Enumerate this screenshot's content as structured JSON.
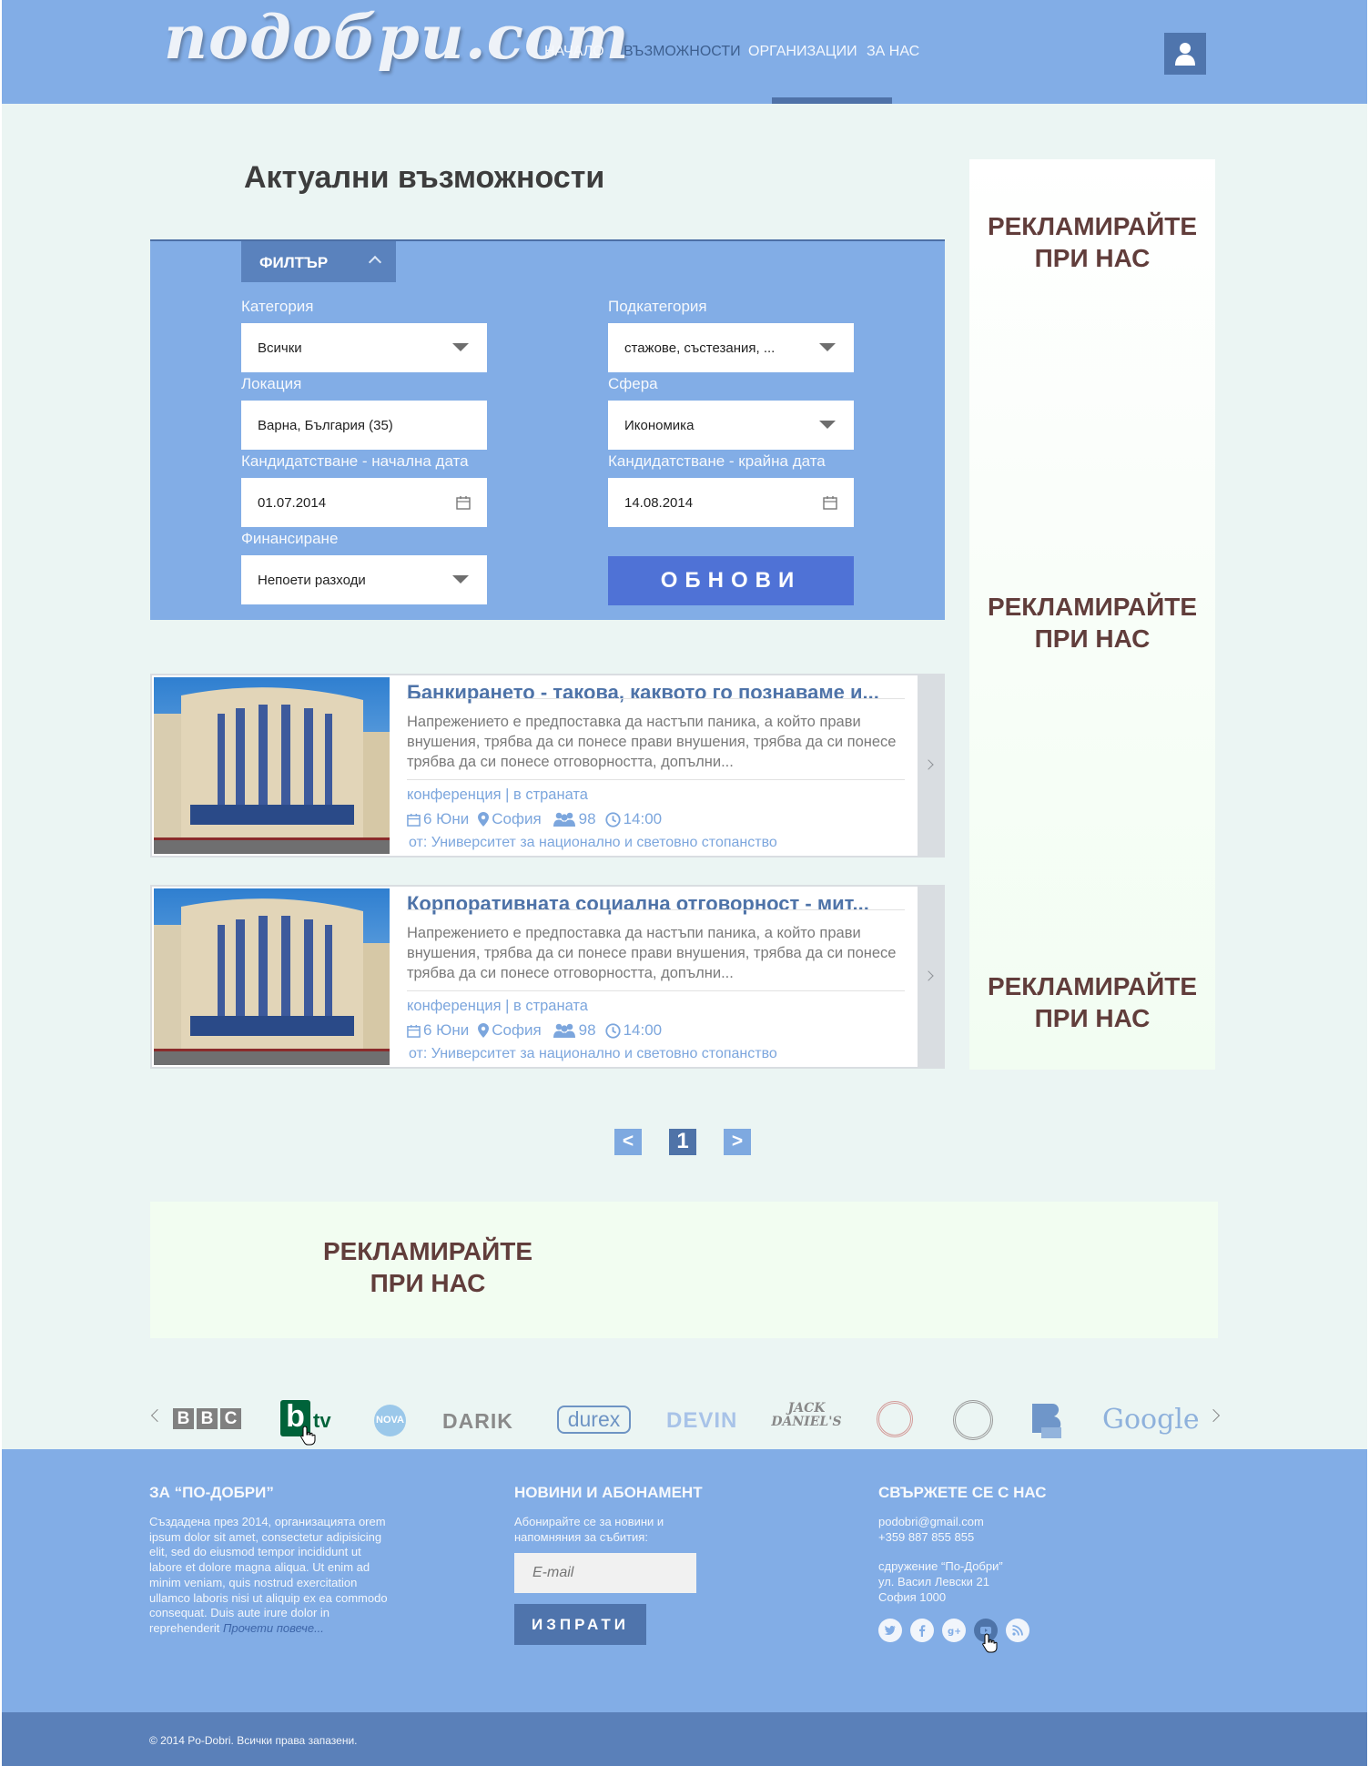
{
  "header": {
    "logo": "подобри.com",
    "nav": [
      "НАЧАЛО",
      "ВЪЗМОЖНОСТИ",
      "ОРГАНИЗАЦИИ",
      "ЗА НАС"
    ],
    "active_nav": "ВЪЗМОЖНОСТИ",
    "user_icon": "user-icon"
  },
  "page": {
    "title": "Актуални възможности"
  },
  "filter": {
    "tab_label": "ФИЛТЪР",
    "category_label": "Категория",
    "category_value": "Всички",
    "subcategory_label": "Подкатегория",
    "subcategory_value": "стажове, състезания, ...",
    "location_label": "Локация",
    "location_value": "Варна, България (35)",
    "sphere_label": "Сфера",
    "sphere_value": "Икономика",
    "start_label": "Кандидатстване - начална дата",
    "start_value": "01.07.2014",
    "end_label": "Кандидатстване - крайна дата",
    "end_value": "14.08.2014",
    "funding_label": "Финансиране",
    "funding_value": "Непоети разходи",
    "update_button": "ОБНОВИ"
  },
  "cards": [
    {
      "title": "Банкирането - такова, каквото го познаваме и...",
      "desc": "Напрежението е предпоставка да настъпи паника, а който прави внушения, трябва да си понесе прави внушения, трябва да си понесе трябва да си понесе отговорността, допълни...",
      "tags": "конференция | в страната",
      "date": "6 Юни",
      "city": "София",
      "people": "98",
      "time": "14:00",
      "org": "от: Университет за национално и световно стопанство"
    },
    {
      "title": "Корпоративната социална отговорност - мит...",
      "desc": "Напрежението е предпоставка да настъпи паника, а който прави внушения, трябва да си понесе прави внушения, трябва да си понесе трябва да си понесе отговорността, допълни...",
      "tags": "конференция | в страната",
      "date": "6 Юни",
      "city": "София",
      "people": "98",
      "time": "14:00",
      "org": "от: Университет за национално и световно стопанство"
    }
  ],
  "pagination": {
    "prev": "<",
    "current": "1",
    "next": ">"
  },
  "ads": {
    "line1": "РЕКЛАМИРАЙТЕ",
    "line2": "ПРИ НАС"
  },
  "brands": {
    "bbc": "BBC",
    "btv_b": "b",
    "btv_tv": "tv",
    "nova": "NOVA",
    "darik": "DARIK",
    "durex": "durex",
    "devin": "DEVIN",
    "jack": "JACK DANIEL'S",
    "google": "Google"
  },
  "footer": {
    "about_head": "ЗА “ПО-ДОБРИ”",
    "about_text": "Създадена през 2014, организацията orem ipsum dolor sit amet, consectetur adipisicing elit, sed do eiusmod tempor incididunt ut labore et dolore magna aliqua. Ut enim ad minim veniam, quis nostrud exercitation ullamco laboris nisi ut aliquip ex ea commodo consequat. Duis aute irure dolor in reprehenderit",
    "about_more": "Прочети повече...",
    "news_head": "НОВИНИ И АБОНАМЕНТ",
    "news_text": "Абонирайте се за новини и напомняния за събития:",
    "email_placeholder": "E-mail",
    "send_button": "ИЗПРАТИ",
    "contact_head": "СВЪРЖЕТЕ СЕ С НАС",
    "contact_email": "podobri@gmail.com",
    "contact_phone": "+359 887 855 855",
    "address1": "сдружение “По-Добри”",
    "address2": "ул. Васил Левски 21",
    "address3": "София 1000",
    "social": [
      "twitter-icon",
      "facebook-icon",
      "google-plus-icon",
      "youtube-icon",
      "rss-icon"
    ]
  },
  "copyright": "© 2014 Po-Dobri. Всички права запазени."
}
